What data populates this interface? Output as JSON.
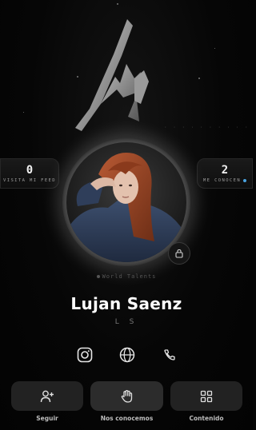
{
  "logo": {
    "subtitle": "· · · · · · · · · ·"
  },
  "stats": {
    "left": {
      "value": "0",
      "label": "VISITA MI FEED"
    },
    "right": {
      "value": "2",
      "label": "ME CONOCEN"
    }
  },
  "profile": {
    "tag": "World Talents",
    "name": "Lujan Saenz",
    "initials": "L S"
  },
  "socials": [
    {
      "icon": "instagram-icon"
    },
    {
      "icon": "globe-icon"
    },
    {
      "icon": "phone-icon"
    }
  ],
  "actions": [
    {
      "label": "Seguir",
      "icon": "add-user-icon"
    },
    {
      "label": "Nos conocemos",
      "icon": "hand-icon"
    },
    {
      "label": "Contenido",
      "icon": "grid-icon"
    }
  ],
  "colors": {
    "background": "#050505",
    "button": "#222222",
    "accent_dot": "#4aa3df"
  }
}
